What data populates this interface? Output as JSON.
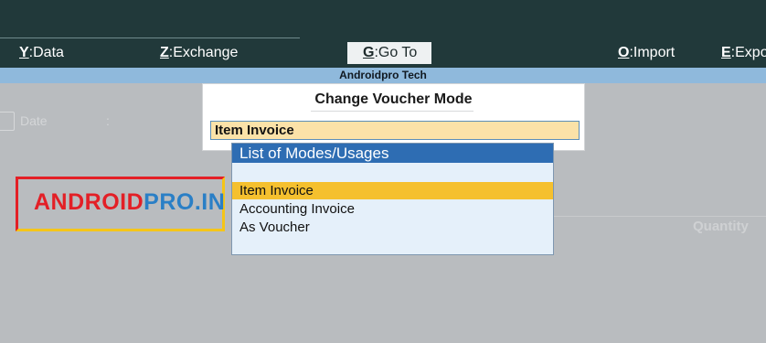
{
  "menu": {
    "data": {
      "key": "Y",
      "label": "Data"
    },
    "exchange": {
      "key": "Z",
      "label": "Exchange"
    },
    "goto": {
      "key": "G",
      "label": "Go To"
    },
    "import": {
      "key": "O",
      "label": "Import"
    },
    "export": {
      "key": "E",
      "label": "Expo"
    }
  },
  "company_name": "Androidpro Tech",
  "background": {
    "date_label": "Date",
    "date_colon": ":",
    "quantity_label": "Quantity"
  },
  "logo": {
    "part1": "ANDROID",
    "part2": "PRO.IN",
    "colors": {
      "red": "#e31f26",
      "blue": "#2a7fc6",
      "yellow": "#f5c518"
    }
  },
  "dialog": {
    "title": "Change Voucher Mode",
    "input_value": "Item Invoice"
  },
  "list": {
    "header": "List of Modes/Usages",
    "items": [
      "Item Invoice",
      "Accounting Invoice",
      "As Voucher"
    ],
    "selected_index": 0
  },
  "colors": {
    "topbar": "#21393a",
    "company_bar": "#8fb9dc",
    "list_header": "#2e6db3",
    "selection": "#f5c02e",
    "input_bg": "#fbe2a8"
  }
}
